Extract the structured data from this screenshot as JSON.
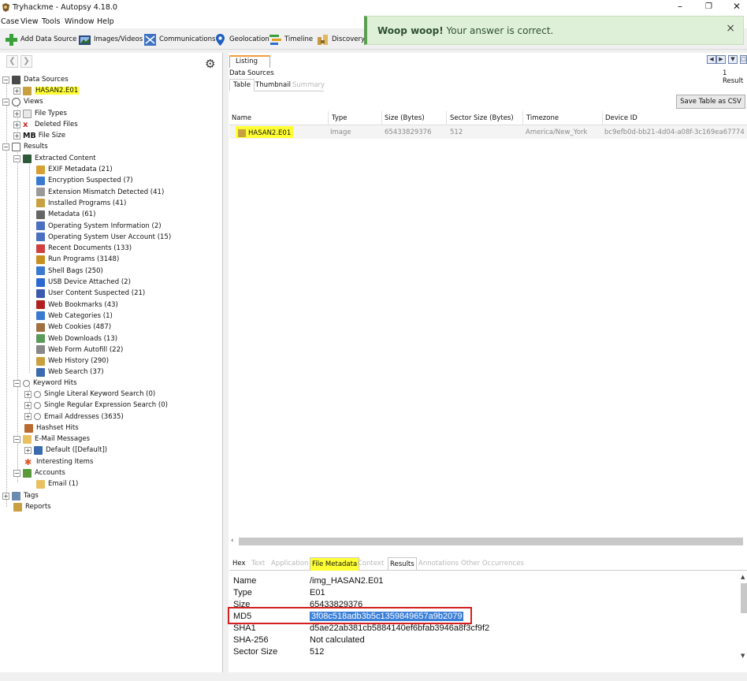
{
  "window": {
    "title": "Tryhackme - Autopsy 4.18.0",
    "minimize": "–",
    "maximize": "❐",
    "close": "✕"
  },
  "menu": [
    "Case",
    "View",
    "Tools",
    "Window",
    "Help"
  ],
  "toolbar": {
    "add_data_source": "Add Data Source",
    "images_videos": "Images/Videos",
    "communications": "Communications",
    "geolocation": "Geolocation",
    "timeline": "Timeline",
    "discovery": "Discovery"
  },
  "toast": {
    "bold": "Woop woop!",
    "text": "Your answer is correct.",
    "close": "×",
    "color": "#dff0d8"
  },
  "nav": {
    "back": "❮",
    "forward": "❯",
    "settings_icon": "⚙"
  },
  "tree": {
    "data_sources": "Data Sources",
    "hasan": "HASAN2.E01",
    "views": "Views",
    "file_types": "File Types",
    "deleted_files": "Deleted Files",
    "mb": "MB",
    "file_size": "File Size",
    "results": "Results",
    "extracted_content": "Extracted Content",
    "extracted": [
      "EXIF Metadata (21)",
      "Encryption Suspected (7)",
      "Extension Mismatch Detected (41)",
      "Installed Programs (41)",
      "Metadata (61)",
      "Operating System Information (2)",
      "Operating System User Account (15)",
      "Recent Documents (133)",
      "Run Programs (3148)",
      "Shell Bags (250)",
      "USB Device Attached (2)",
      "User Content Suspected (21)",
      "Web Bookmarks (43)",
      "Web Categories (1)",
      "Web Cookies (487)",
      "Web Downloads (13)",
      "Web Form Autofill (22)",
      "Web History (290)",
      "Web Search (37)"
    ],
    "keyword_hits": "Keyword Hits",
    "keyword_children": [
      "Single Literal Keyword Search (0)",
      "Single Regular Expression Search (0)",
      "Email Addresses (3635)"
    ],
    "hashset_hits": "Hashset Hits",
    "email_messages": "E-Mail Messages",
    "email_default": "Default ([Default])",
    "interesting_items": "Interesting Items",
    "accounts": "Accounts",
    "email_account": "Email (1)",
    "tags": "Tags",
    "reports": "Reports"
  },
  "listing": {
    "tab": "Listing",
    "breadcrumb": "Data Sources",
    "result_count": "1 Result",
    "subtabs": [
      "Table",
      "Thumbnail",
      "Summary"
    ],
    "save_csv": "Save Table as CSV",
    "columns": [
      "Name",
      "Type",
      "Size (Bytes)",
      "Sector Size (Bytes)",
      "Timezone",
      "Device ID"
    ],
    "rows": [
      [
        "HASAN2.E01",
        "Image",
        "65433829376",
        "512",
        "America/New_York",
        "bc9efb0d-bb21-4d04-a08f-3c169ea67774"
      ]
    ]
  },
  "bottom_tabs": [
    "Hex",
    "Text",
    "Application",
    "File Metadata",
    "Context",
    "Results",
    "Annotations",
    "Other Occurrences"
  ],
  "metadata": [
    {
      "key": "Name",
      "value": "/img_HASAN2.E01"
    },
    {
      "key": "Type",
      "value": "E01"
    },
    {
      "key": "Size",
      "value": "65433829376"
    },
    {
      "key": "MD5",
      "value": "3f08c518adb3b5c1359849657a9b2079"
    },
    {
      "key": "SHA1",
      "value": "d5ae22ab381cb5884140ef6bfab3946a8f3cf9f2"
    },
    {
      "key": "SHA-256",
      "value": "Not calculated"
    },
    {
      "key": "Sector Size",
      "value": "512"
    }
  ],
  "colors": {
    "highlight": "#ffff33",
    "selection": "#3b7fd8",
    "annotation": "#d42020"
  }
}
